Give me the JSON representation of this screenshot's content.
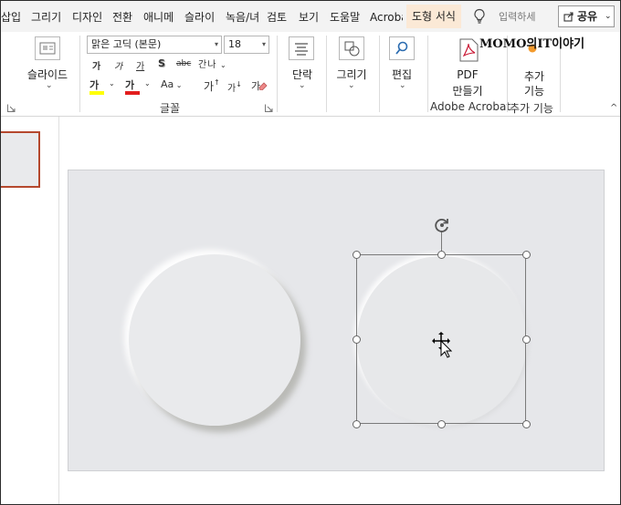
{
  "tabs": [
    {
      "label": "삽입"
    },
    {
      "label": "그리기"
    },
    {
      "label": "디자인"
    },
    {
      "label": "전환"
    },
    {
      "label": "애니메"
    },
    {
      "label": "슬라이"
    },
    {
      "label": "녹음/녀"
    },
    {
      "label": "검토"
    },
    {
      "label": "보기"
    },
    {
      "label": "도움말"
    },
    {
      "label": "Acroba"
    },
    {
      "label": "도형 서식"
    }
  ],
  "tell_me": {
    "placeholder": "입력하세"
  },
  "share": {
    "label": "공유"
  },
  "watermark": {
    "text": "MOMO의IT이야기"
  },
  "ribbon": {
    "slides_group": {
      "new_slide_label": "슬라이드"
    },
    "font_group": {
      "font_name": "맑은 고딕 (본문)",
      "font_size": "18",
      "row1": [
        "가",
        "가",
        "가",
        "S",
        "abc",
        "간나"
      ],
      "row2": [
        "가",
        "가",
        "Aa",
        "가",
        "가",
        "가"
      ],
      "label": "글꼴"
    },
    "paragraph": {
      "label": "단락"
    },
    "drawing": {
      "label": "그리기"
    },
    "editing": {
      "label": "편집"
    },
    "pdf": {
      "line1": "PDF",
      "line2": "만들기",
      "group_label": "Adobe Acrobat"
    },
    "addins": {
      "line1": "추가",
      "line2": "기능",
      "group_label": "추가 기능"
    }
  },
  "colors": {
    "highlight": "#ffff00",
    "font_color": "#e21d1d",
    "thumb_border": "#b5482d",
    "tab_context_bg": "#fbe9d6"
  }
}
